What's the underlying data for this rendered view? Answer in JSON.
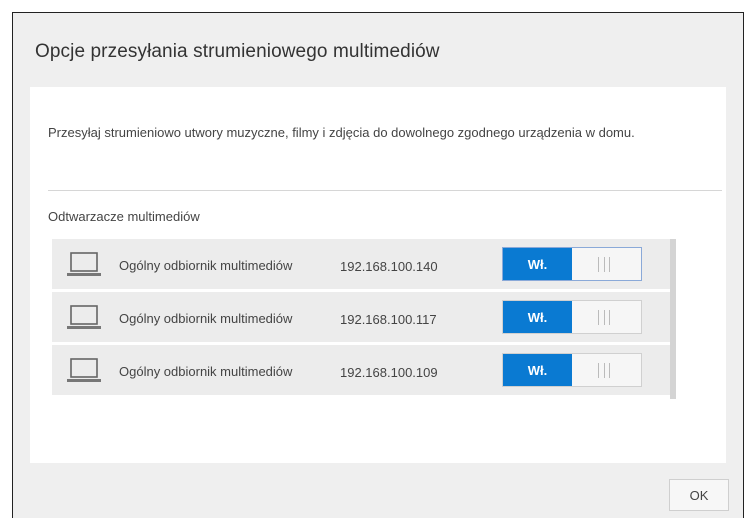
{
  "dialog": {
    "title": "Opcje przesyłania strumieniowego multimediów",
    "description": "Przesyłaj strumieniowo utwory muzyczne, filmy i zdjęcia do dowolnego zgodnego urządzenia w domu.",
    "section_label": "Odtwarzacze multimediów",
    "ok_label": "OK"
  },
  "players": [
    {
      "name": "Ogólny odbiornik multimediów",
      "ip": "192.168.100.140",
      "toggle_label": "Wł.",
      "enabled": true
    },
    {
      "name": "Ogólny odbiornik multimediów",
      "ip": "192.168.100.117",
      "toggle_label": "Wł.",
      "enabled": true
    },
    {
      "name": "Ogólny odbiornik multimediów",
      "ip": "192.168.100.109",
      "toggle_label": "Wł.",
      "enabled": true
    }
  ],
  "icons": {
    "device": "laptop-icon",
    "toggle_grip": "grip-icon"
  },
  "colors": {
    "accent": "#0a7ad2",
    "background": "#efefef",
    "panel": "#ffffff",
    "row": "#ececec"
  }
}
